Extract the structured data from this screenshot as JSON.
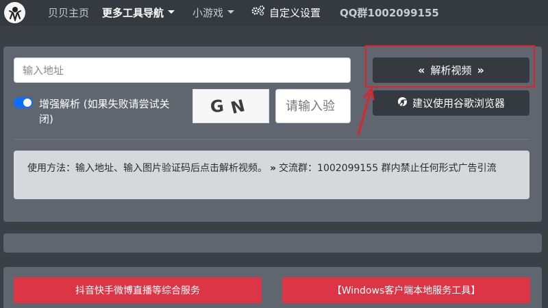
{
  "navbar": {
    "logo_icon": "astronaut-logo-icon",
    "items": [
      {
        "label": "贝贝主页",
        "active": false
      },
      {
        "label": "更多工具导航",
        "active": true,
        "dropdown": true
      },
      {
        "label": "小游戏",
        "active": false,
        "dropdown": true
      },
      {
        "label": "自定义设置",
        "active": false,
        "icon": "gears-icon"
      },
      {
        "label": "QQ群1002099155",
        "active": false
      }
    ]
  },
  "form": {
    "url_placeholder": "输入地址",
    "parse_button": {
      "label": "解析视频",
      "left_icon": "«",
      "right_icon": "»"
    },
    "chrome_button": {
      "label": "建议使用谷歌浏览器",
      "icon": "chrome-icon"
    },
    "enhance_toggle": {
      "checked": true,
      "label": "增强解析 (如果失败请尝试关闭)"
    },
    "captcha": {
      "text_1": "G",
      "text_2": "N",
      "input_placeholder": "请输入验"
    }
  },
  "info": {
    "part1": "使用方法：输入地址、输入图片验证码后点击解析视频。",
    "separator": "»",
    "part2": "交流群：1002099155 群内禁止任何形式广告引流"
  },
  "bottom_buttons": [
    {
      "label": "抖音快手微博直播等综合服务"
    },
    {
      "label": "【Windows客户端本地服务工具】"
    }
  ],
  "colors": {
    "navbar": "#343a40",
    "card": "#5f666f",
    "danger": "#dc3545",
    "highlight": "#e0222a",
    "toggle": "#0d6efd"
  }
}
